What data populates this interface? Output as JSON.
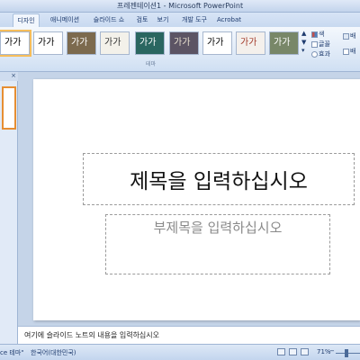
{
  "window": {
    "title": "프레젠테이션1 - Microsoft PowerPoint"
  },
  "tabs": [
    {
      "label": "디자인",
      "active": true
    },
    {
      "label": "애니메이션"
    },
    {
      "label": "슬라이드 쇼"
    },
    {
      "label": "검토"
    },
    {
      "label": "보기"
    },
    {
      "label": "개발 도구"
    },
    {
      "label": "Acrobat"
    }
  ],
  "ribbon": {
    "themes": [
      {
        "label": "가가",
        "bg": "#ffffff",
        "fg": "#000000",
        "selected": true
      },
      {
        "label": "가가",
        "bg": "#ffffff",
        "fg": "#000000"
      },
      {
        "label": "가가",
        "bg": "#7c6a4e",
        "fg": "#ffffff"
      },
      {
        "label": "가가",
        "bg": "#f3f1ea",
        "fg": "#333333"
      },
      {
        "label": "가가",
        "bg": "#2a6660",
        "fg": "#ffffff"
      },
      {
        "label": "가가",
        "bg": "#5c5464",
        "fg": "#e8e0d0"
      },
      {
        "label": "가가",
        "bg": "#ffffff",
        "fg": "#000000"
      },
      {
        "label": "가가",
        "bg": "#f4f0ec",
        "fg": "#a33a2a"
      },
      {
        "label": "가가",
        "bg": "#788768",
        "fg": "#ffffff"
      }
    ],
    "group_label": "테마",
    "options": {
      "colors": "색",
      "fonts": "글꼴",
      "effects": "효과"
    },
    "right_labels": [
      "배",
      "배"
    ]
  },
  "notes": {
    "text": "여기에 슬라이드 노트의 내용을 입력하십시오"
  },
  "slide": {
    "title_placeholder": "제목을 입력하십시오",
    "subtitle_placeholder": "부제목을 입력하십시오"
  },
  "status": {
    "theme": "ce 테마\"",
    "language": "한국어(대한민국)",
    "zoom": "71%"
  }
}
